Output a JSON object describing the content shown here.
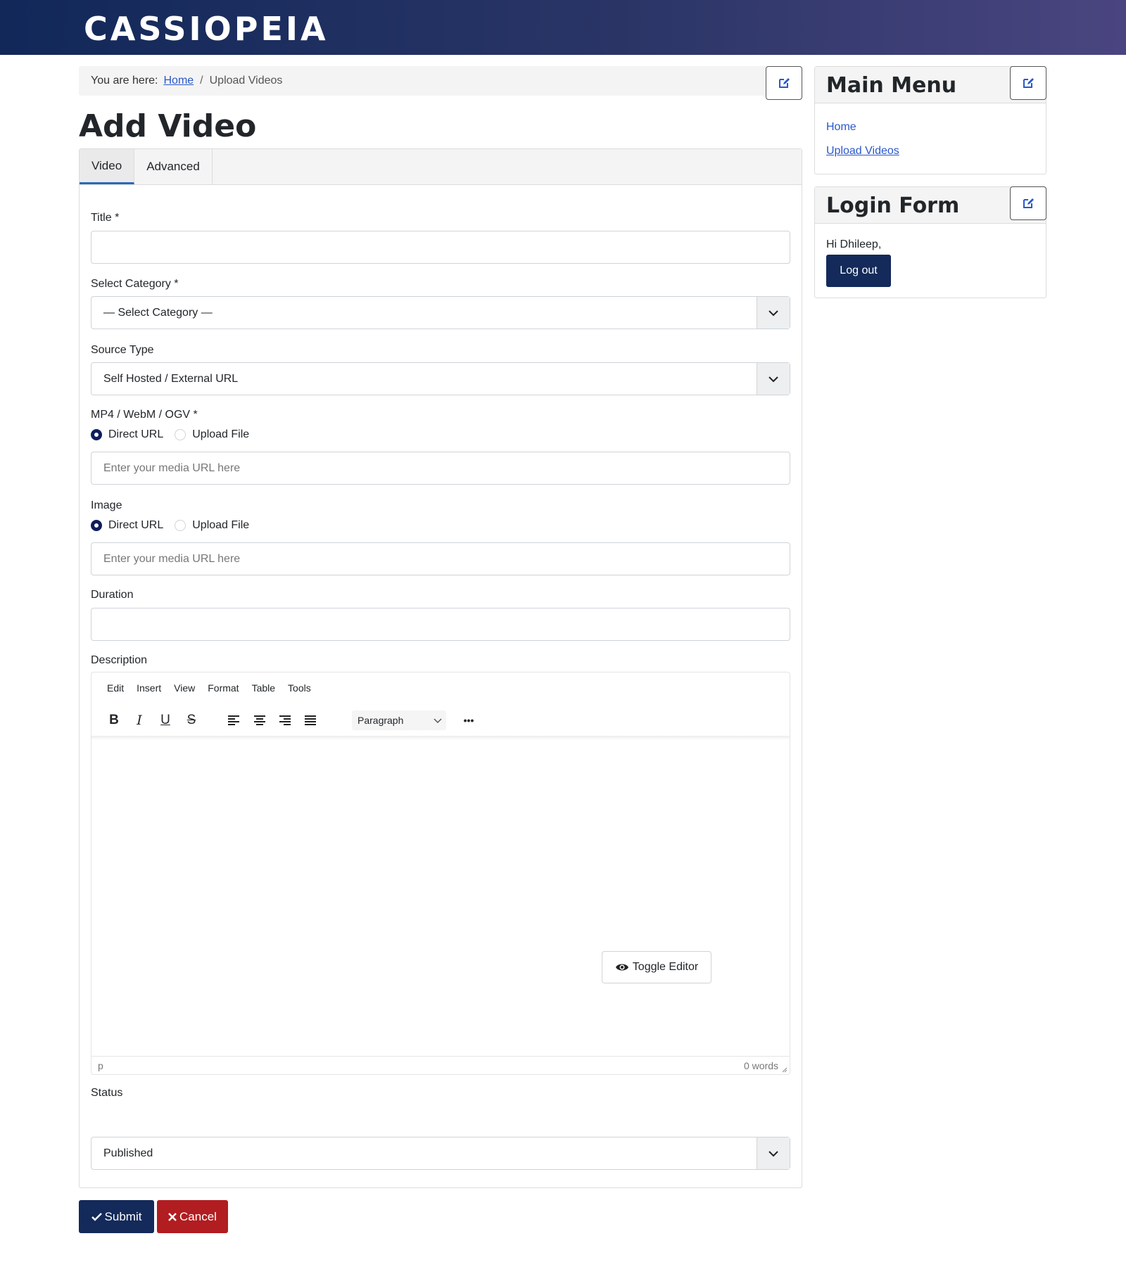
{
  "site": {
    "brand": "CASSIOPEIA"
  },
  "breadcrumb": {
    "prefix": "You are here:",
    "home": "Home",
    "separator": "/",
    "current": "Upload Videos"
  },
  "page": {
    "title": "Add Video"
  },
  "tabs": [
    {
      "label": "Video",
      "active": true
    },
    {
      "label": "Advanced",
      "active": false
    }
  ],
  "form": {
    "title_label": "Title *",
    "title_value": "",
    "category_label": "Select Category *",
    "category_selected": "— Select Category —",
    "source_type_label": "Source Type",
    "source_type_selected": "Self Hosted / External URL",
    "media_label": "MP4 / WebM / OGV *",
    "media_radio_direct": "Direct URL",
    "media_radio_upload": "Upload File",
    "media_placeholder": "Enter your media URL here",
    "image_label": "Image",
    "image_radio_direct": "Direct URL",
    "image_radio_upload": "Upload File",
    "image_placeholder": "Enter your media URL here",
    "duration_label": "Duration",
    "duration_value": "",
    "description_label": "Description",
    "status_label": "Status",
    "status_selected": "Published",
    "toggle_editor": "Toggle Editor"
  },
  "editor": {
    "menu": [
      "Edit",
      "Insert",
      "View",
      "Format",
      "Table",
      "Tools"
    ],
    "block_format": "Paragraph",
    "bold": "B",
    "italic": "I",
    "underline": "U",
    "strike": "S",
    "more": "•••",
    "path": "p",
    "word_count": "0 words"
  },
  "actions": {
    "submit": "Submit",
    "cancel": "Cancel"
  },
  "sidebar": {
    "main_menu": {
      "title": "Main Menu",
      "items": [
        "Home",
        "Upload Videos"
      ]
    },
    "login_form": {
      "title": "Login Form",
      "greeting": "Hi Dhileep,",
      "logout": "Log out"
    }
  },
  "colors": {
    "header_start": "#112859",
    "header_end": "#4a4580",
    "primary": "#132a5a",
    "danger": "#b11d20",
    "link": "#2a58c9"
  }
}
